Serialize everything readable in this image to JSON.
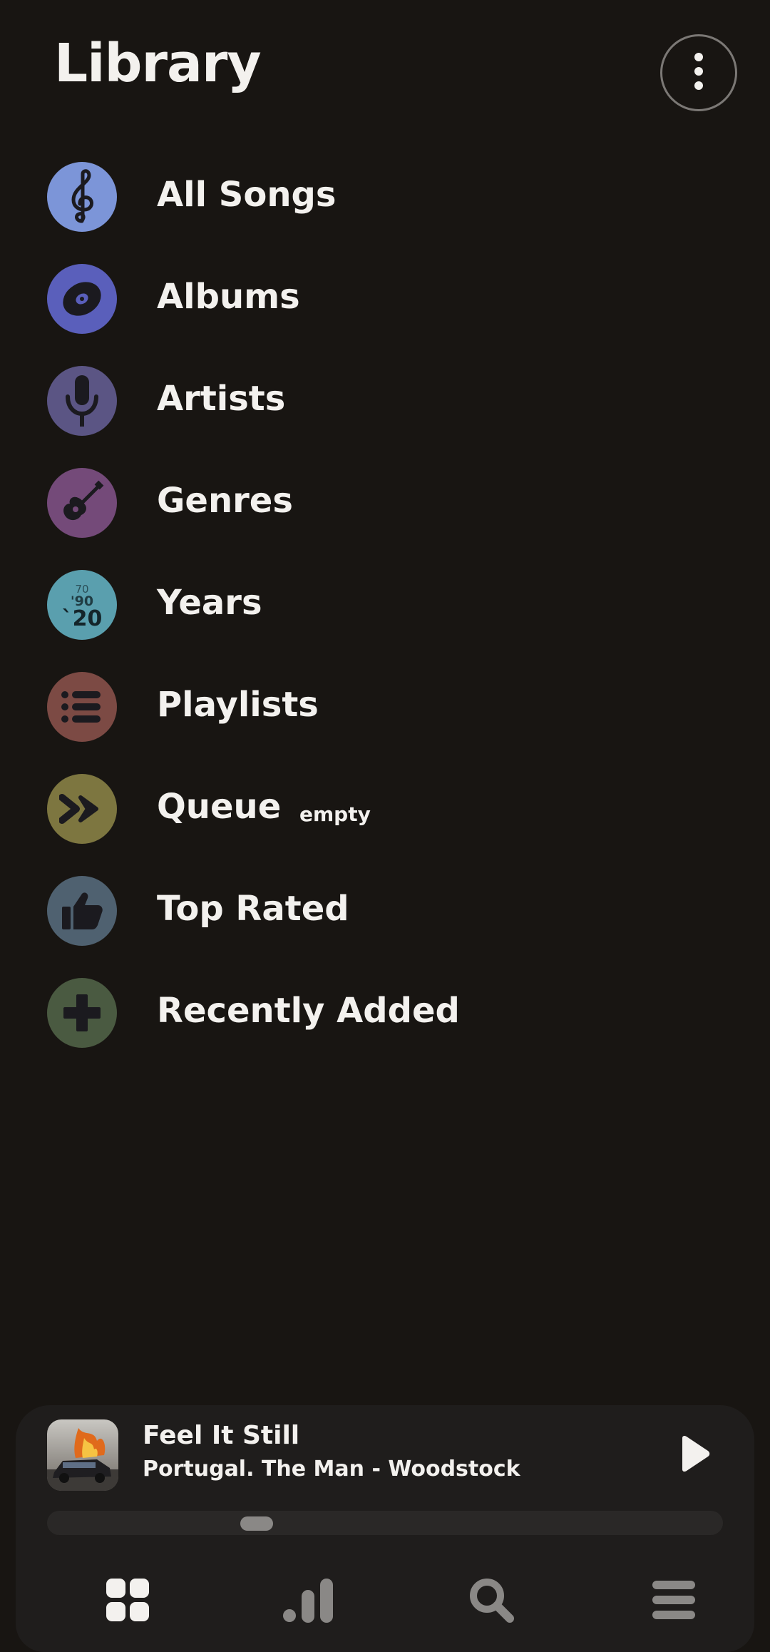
{
  "header": {
    "title": "Library",
    "more_icon": "more-vert-icon"
  },
  "library": {
    "items": [
      {
        "label": "All Songs",
        "icon": "treble-clef-icon",
        "color": "#7c95d8"
      },
      {
        "label": "Albums",
        "icon": "disc-icon",
        "color": "#5a5fbb"
      },
      {
        "label": "Artists",
        "icon": "microphone-icon",
        "color": "#5b5584"
      },
      {
        "label": "Genres",
        "icon": "guitar-icon",
        "color": "#744a79"
      },
      {
        "label": "Years",
        "icon": "years-icon",
        "color": "#5a9fae",
        "years": [
          "70",
          "'90",
          "`20"
        ]
      },
      {
        "label": "Playlists",
        "icon": "list-icon",
        "color": "#7c4a44"
      },
      {
        "label": "Queue",
        "icon": "fast-forward-icon",
        "color": "#7d7640",
        "badge": "empty"
      },
      {
        "label": "Top Rated",
        "icon": "thumbs-up-icon",
        "color": "#4f6170"
      },
      {
        "label": "Recently Added",
        "icon": "plus-icon",
        "color": "#4a5a41"
      }
    ]
  },
  "player": {
    "title": "Feel It Still",
    "subtitle": "Portugal. The Man - Woodstock",
    "progress": 0.3,
    "play_icon": "play-icon"
  },
  "nav": {
    "items": [
      {
        "icon": "grid-icon",
        "active": true
      },
      {
        "icon": "bar-chart-icon",
        "active": false
      },
      {
        "icon": "search-icon",
        "active": false
      },
      {
        "icon": "menu-icon",
        "active": false
      }
    ]
  }
}
